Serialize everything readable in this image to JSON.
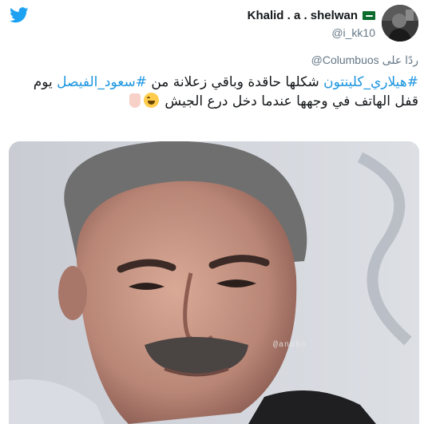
{
  "user": {
    "display_name": "Khalid . a . shelwan",
    "handle": "@i_kk10"
  },
  "reply": {
    "prefix": "ردًا على",
    "mention": "@Columbuos"
  },
  "tweet": {
    "hashtag1": "#هيلاري_كلينتون",
    "text1": " شكلها حاقدة وباقي زعلانة من ",
    "hashtag2": "#سعود_الفيصل",
    "text2": " يوم قفل الهاتف في وجهها عندما دخل درع الجيش "
  },
  "media": {
    "watermark": "@anabn"
  },
  "icons": {
    "brand": "twitter-bird-icon",
    "flag": "saudi-flag-icon",
    "emoji1": "face-with-tears-of-joy-emoji",
    "emoji2": "backhand-index-pointing-down-emoji"
  },
  "colors": {
    "link": "#1b95e0",
    "brand": "#1da1f2",
    "secondary_text": "#657786"
  }
}
